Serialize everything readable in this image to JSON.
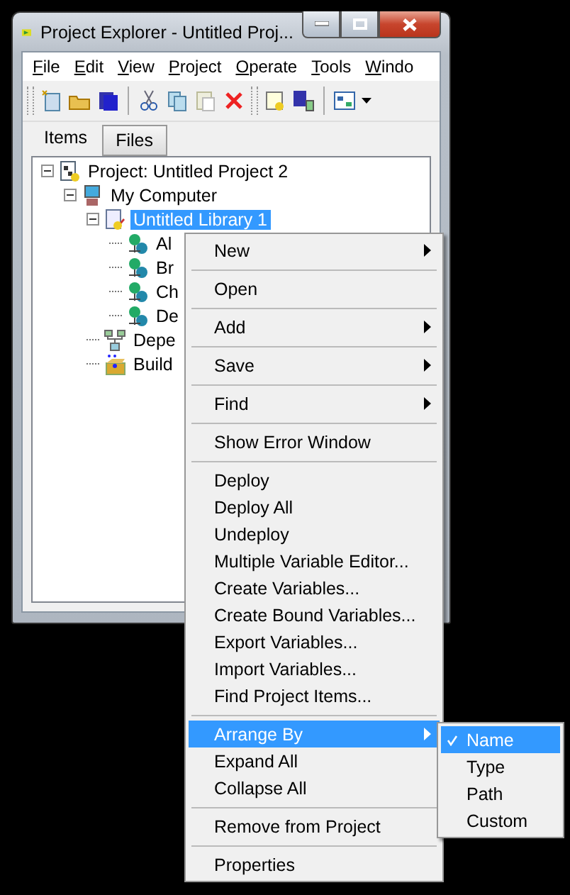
{
  "window": {
    "title": "Project Explorer - Untitled Proj..."
  },
  "menu_bar": [
    "File",
    "Edit",
    "View",
    "Project",
    "Operate",
    "Tools",
    "Windo"
  ],
  "tabs": [
    {
      "label": "Items",
      "selected": true
    },
    {
      "label": "Files",
      "selected": false
    }
  ],
  "tree": [
    {
      "label": "Project: Untitled Project 2",
      "kind": "project",
      "expanded": true,
      "selected": false,
      "children": [
        {
          "label": "My Computer",
          "kind": "computer",
          "expanded": true,
          "selected": false,
          "children": [
            {
              "label": "Untitled Library 1",
              "kind": "library",
              "expanded": true,
              "selected": true,
              "children": [
                {
                  "label": "Al",
                  "kind": "variable",
                  "selected": false
                },
                {
                  "label": "Br",
                  "kind": "variable",
                  "selected": false
                },
                {
                  "label": "Ch",
                  "kind": "variable",
                  "selected": false
                },
                {
                  "label": "De",
                  "kind": "variable",
                  "selected": false
                }
              ]
            },
            {
              "label": "Depe",
              "kind": "dependencies",
              "selected": false
            },
            {
              "label": "Build",
              "kind": "build",
              "selected": false
            }
          ]
        }
      ]
    }
  ],
  "context_menu": {
    "groups": [
      [
        {
          "label": "New",
          "submenu": true,
          "selected": false
        }
      ],
      [
        {
          "label": "Open",
          "submenu": false,
          "selected": false
        }
      ],
      [
        {
          "label": "Add",
          "submenu": true,
          "selected": false
        }
      ],
      [
        {
          "label": "Save",
          "submenu": true,
          "selected": false
        }
      ],
      [
        {
          "label": "Find",
          "submenu": true,
          "selected": false
        }
      ],
      [
        {
          "label": "Show Error Window",
          "submenu": false,
          "selected": false
        }
      ],
      [
        {
          "label": "Deploy",
          "submenu": false,
          "selected": false
        },
        {
          "label": "Deploy All",
          "submenu": false,
          "selected": false
        },
        {
          "label": "Undeploy",
          "submenu": false,
          "selected": false
        },
        {
          "label": "Multiple Variable Editor...",
          "submenu": false,
          "selected": false
        },
        {
          "label": "Create Variables...",
          "submenu": false,
          "selected": false
        },
        {
          "label": "Create Bound Variables...",
          "submenu": false,
          "selected": false
        },
        {
          "label": "Export Variables...",
          "submenu": false,
          "selected": false
        },
        {
          "label": "Import Variables...",
          "submenu": false,
          "selected": false
        },
        {
          "label": "Find Project Items...",
          "submenu": false,
          "selected": false
        }
      ],
      [
        {
          "label": "Arrange By",
          "submenu": true,
          "selected": true
        },
        {
          "label": "Expand All",
          "submenu": false,
          "selected": false
        },
        {
          "label": "Collapse All",
          "submenu": false,
          "selected": false
        }
      ],
      [
        {
          "label": "Remove from Project",
          "submenu": false,
          "selected": false
        }
      ],
      [
        {
          "label": "Properties",
          "submenu": false,
          "selected": false
        }
      ]
    ]
  },
  "submenu": [
    {
      "label": "Name",
      "checked": true,
      "selected": true
    },
    {
      "label": "Type",
      "checked": false,
      "selected": false
    },
    {
      "label": "Path",
      "checked": false,
      "selected": false
    },
    {
      "label": "Custom",
      "checked": false,
      "selected": false
    }
  ]
}
